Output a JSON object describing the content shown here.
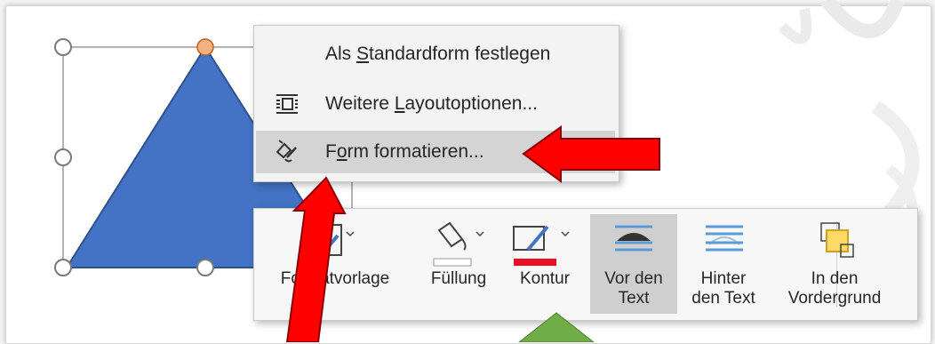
{
  "context_menu": {
    "items": [
      {
        "label_before": "Als ",
        "label_accel": "S",
        "label_after": "tandardform festlegen",
        "icon": "none"
      },
      {
        "label_before": "Weitere ",
        "label_accel": "L",
        "label_after": "ayoutoptionen...",
        "icon": "layout-options-icon"
      },
      {
        "label_before": "F",
        "label_accel": "o",
        "label_after": "rm formatieren...",
        "icon": "format-shape-icon"
      }
    ],
    "highlighted_index": 2
  },
  "mini_toolbar": {
    "buttons": [
      {
        "line1": "Formatvorlage",
        "line2": "",
        "icon": "shape-style-icon"
      },
      {
        "line1": "Füllung",
        "line2": "",
        "icon": "fill-bucket-icon"
      },
      {
        "line1": "Kontur",
        "line2": "",
        "icon": "outline-pen-icon"
      },
      {
        "line1": "Vor den",
        "line2": "Text",
        "icon": "in-front-of-text-icon",
        "active": true
      },
      {
        "line1": "Hinter",
        "line2": "den Text",
        "icon": "behind-text-icon"
      },
      {
        "line1": "In den",
        "line2": "Vordergrund",
        "icon": "bring-to-front-icon"
      }
    ]
  },
  "colors": {
    "shape_fill": "#4472c4",
    "shape_stroke": "#2f528f",
    "arrow_red": "#ff0000",
    "arrow_green": "#70ad47",
    "fill_swatch": "#ffffff",
    "outline_swatch": "#e81123",
    "icon_blue": "#5b9bd5",
    "icon_orange": "#ffc000"
  }
}
